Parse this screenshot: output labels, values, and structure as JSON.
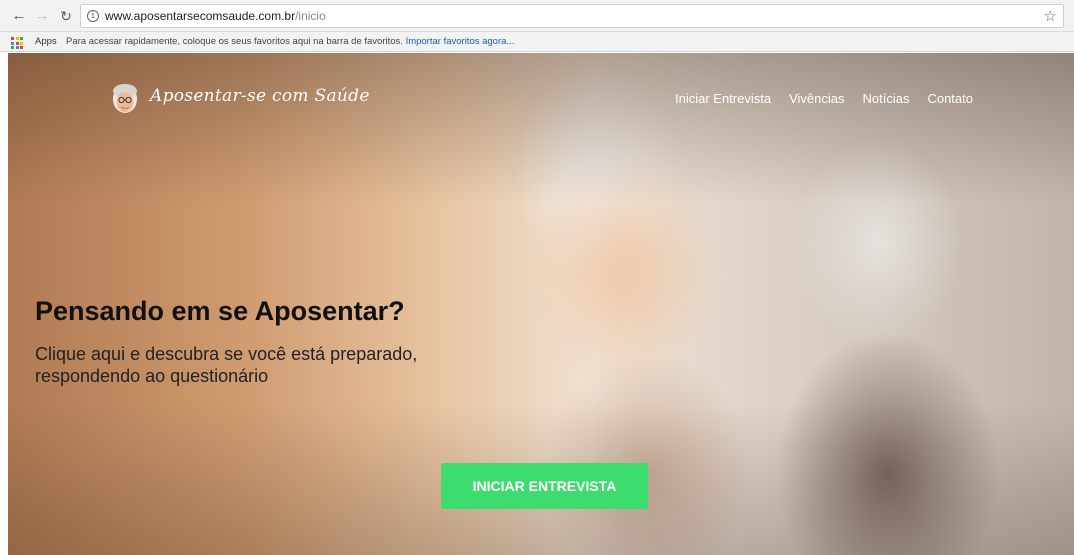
{
  "browser": {
    "url_host": "www.aposentarsecomsaude.com.br",
    "url_path": "/inicio",
    "bookmarks": {
      "apps_label": "Apps",
      "hint_text": "Para acessar rapidamente, coloque os seus favoritos aqui na barra de favoritos.",
      "import_link": "Importar favoritos agora..."
    }
  },
  "site": {
    "brand": "Aposentar-se com Saúde",
    "nav": [
      "Iniciar Entrevista",
      "Vivências",
      "Notícias",
      "Contato"
    ]
  },
  "hero": {
    "headline": "Pensando em se Aposentar?",
    "subline": "Clique aqui e descubra se você está preparado, respondendo ao questionário",
    "cta_label": "INICIAR ENTREVISTA",
    "cta_color": "#3ddc6e"
  },
  "icons": [
    "back-arrow-icon",
    "forward-arrow-icon",
    "reload-icon",
    "info-icon",
    "star-icon",
    "apps-grid-icon",
    "logo-icon"
  ]
}
